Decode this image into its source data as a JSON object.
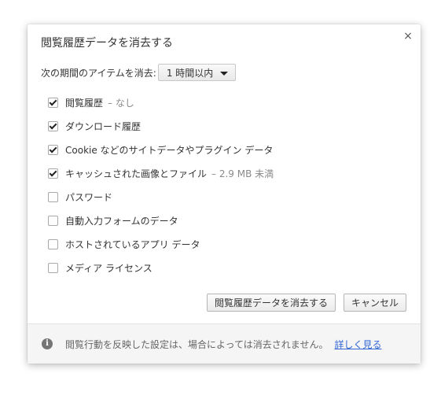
{
  "dialog": {
    "title": "閲覧履歴データを消去する",
    "close_label": "×"
  },
  "period": {
    "label": "次の期間のアイテムを消去:",
    "selected": "1 時間以内"
  },
  "options": [
    {
      "label": "閲覧履歴",
      "extra": "– なし",
      "checked": true
    },
    {
      "label": "ダウンロード履歴",
      "extra": "",
      "checked": true
    },
    {
      "label": "Cookie などのサイトデータやプラグイン データ",
      "extra": "",
      "checked": true
    },
    {
      "label": "キャッシュされた画像とファイル",
      "extra": "– 2.9 MB 未満",
      "checked": true
    },
    {
      "label": "パスワード",
      "extra": "",
      "checked": false
    },
    {
      "label": "自動入力フォームのデータ",
      "extra": "",
      "checked": false
    },
    {
      "label": "ホストされているアプリ データ",
      "extra": "",
      "checked": false
    },
    {
      "label": "メディア ライセンス",
      "extra": "",
      "checked": false
    }
  ],
  "buttons": {
    "clear_label": "閲覧履歴データを消去する",
    "cancel_label": "キャンセル"
  },
  "footer": {
    "icon": "info-icon",
    "text": "閲覧行動を反映した設定は、場合によっては消去されません。",
    "link": "詳しく見る"
  },
  "colors": {
    "link": "#3367d6",
    "muted_text": "#8a8a8a",
    "footer_bg": "#f5f5f5"
  }
}
